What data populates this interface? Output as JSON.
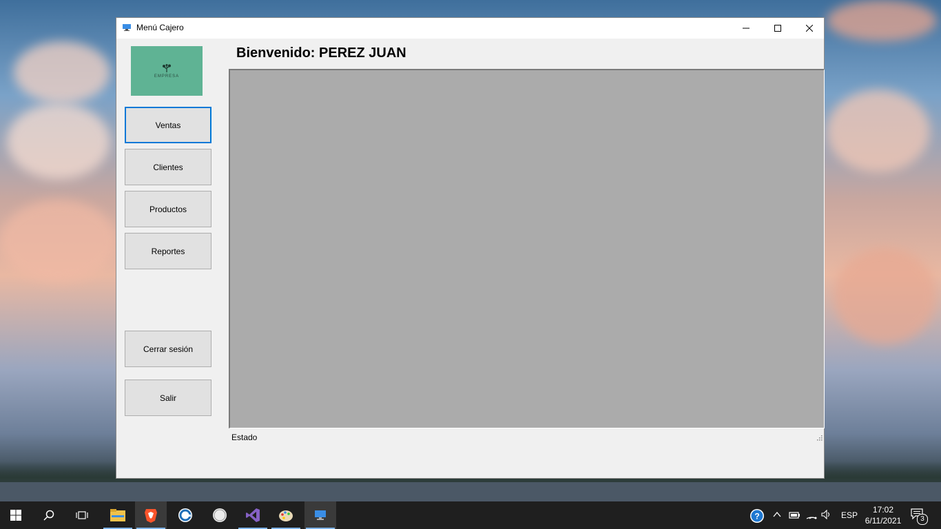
{
  "window": {
    "title": "Menú Cajero",
    "welcome": "Bienvenido: PEREZ JUAN",
    "logo_text": "EMPRESA",
    "status": "Estado"
  },
  "sidebar": {
    "buttons": [
      {
        "label": "Ventas"
      },
      {
        "label": "Clientes"
      },
      {
        "label": "Productos"
      },
      {
        "label": "Reportes"
      },
      {
        "label": "Cerrar sesión"
      },
      {
        "label": "Salir"
      }
    ]
  },
  "taskbar": {
    "language": "ESP",
    "time": "17:02",
    "date": "6/11/2021",
    "notifications": "3"
  },
  "colors": {
    "accent": "#0078d7",
    "logo_bg": "#5fb394",
    "content_bg": "#ababab"
  }
}
